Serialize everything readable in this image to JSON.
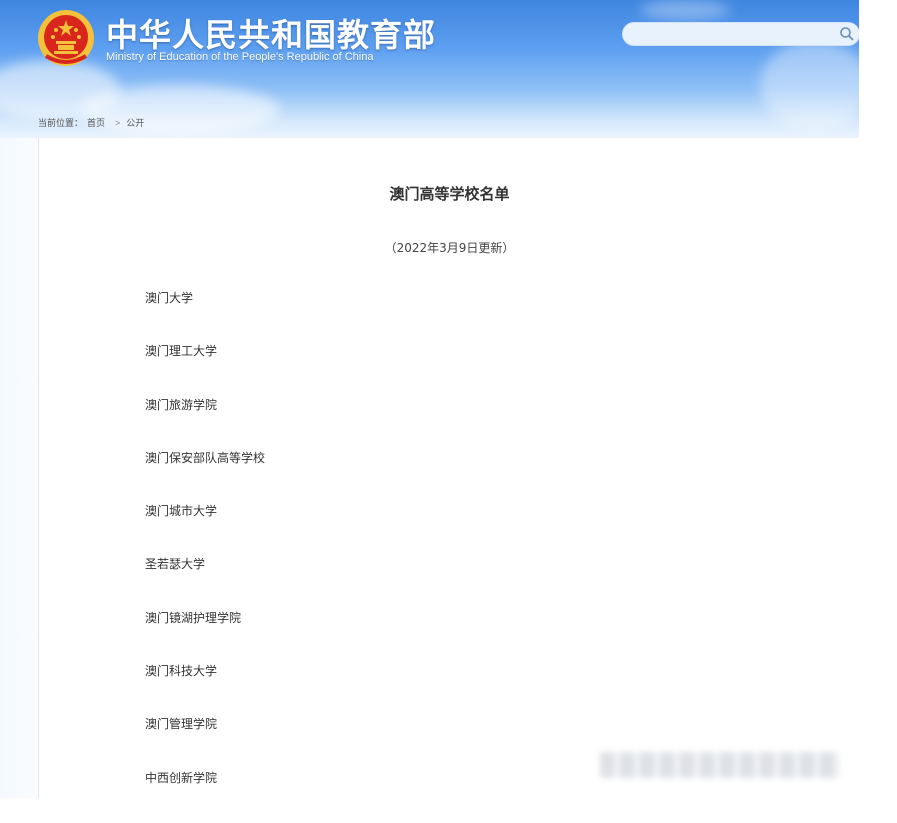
{
  "header": {
    "title": "中华人民共和国教育部",
    "subtitle": "Ministry of Education of the People's Republic of China",
    "search": {
      "placeholder": ""
    }
  },
  "breadcrumb": {
    "label": "当前位置：",
    "items": [
      "首页",
      "公开"
    ]
  },
  "main": {
    "title": "澳门高等学校名单",
    "date": "（2022年3月9日更新）",
    "schools": [
      "澳门大学",
      "澳门理工大学",
      "澳门旅游学院",
      "澳门保安部队高等学校",
      "澳门城市大学",
      "圣若瑟大学",
      "澳门镜湖护理学院",
      "澳门科技大学",
      "澳门管理学院",
      "中西创新学院"
    ]
  },
  "colors": {
    "header_top": "#3f86e0",
    "header_bottom": "#eaf4fe",
    "emblem_red": "#d8261c",
    "emblem_gold": "#f3c13a"
  },
  "icons": {
    "emblem": "national-emblem-icon",
    "search": "search-icon"
  }
}
